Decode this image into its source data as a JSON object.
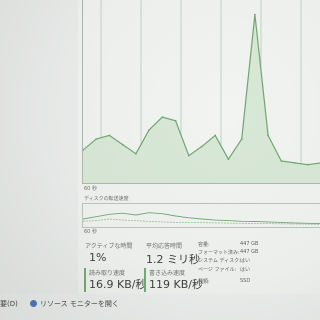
{
  "main_chart": {
    "time_label": "60 秒",
    "series_color": "#6ea56c",
    "fill_color": "#d8e8d6",
    "values": [
      0.18,
      0.24,
      0.26,
      0.21,
      0.16,
      0.29,
      0.36,
      0.34,
      0.15,
      0.2,
      0.26,
      0.13,
      0.24,
      0.92,
      0.26,
      0.12,
      0.11,
      0.1,
      0.11
    ]
  },
  "transfer": {
    "label": "ディスクの転送速度",
    "time_label": "60 秒"
  },
  "stats": {
    "active_time_label": "アクティブな時間",
    "active_time_value": "1%",
    "avg_response_label": "平均応答時間",
    "avg_response_value": "1.2 ミリ秒",
    "read_speed_label": "読み取り速度",
    "read_speed_value": "16.9 KB/秒",
    "write_speed_label": "書き込み速度",
    "write_speed_value": "119 KB/秒"
  },
  "info": {
    "capacity_label": "容量:",
    "capacity_value": "447 GB",
    "formatted_label": "フォーマット済み:",
    "formatted_value": "447 GB",
    "system_disk_label": "システム ディスク:",
    "system_disk_value": "はい",
    "page_file_label": "ページ ファイル:",
    "page_file_value": "はい",
    "type_label": "種類:",
    "type_value": "SSD"
  },
  "footer": {
    "less_details": "要(D)",
    "resource_monitor": "リソース モニターを開く"
  }
}
